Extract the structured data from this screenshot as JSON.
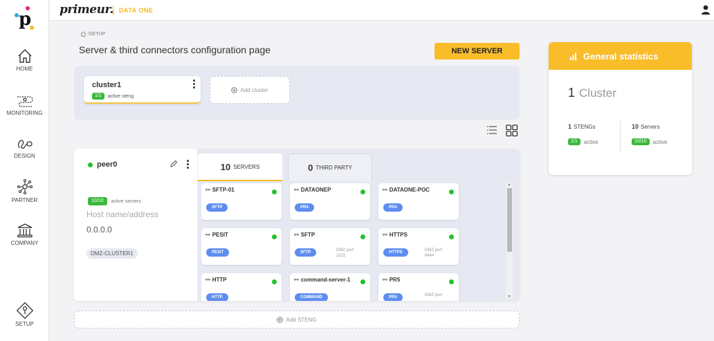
{
  "brand": {
    "name": "primeur.",
    "product": "DATA ONE"
  },
  "nav": [
    {
      "id": "home",
      "label": "HOME"
    },
    {
      "id": "monitoring",
      "label": "MONITORING"
    },
    {
      "id": "design",
      "label": "DESIGN"
    },
    {
      "id": "partner",
      "label": "PARTNER"
    },
    {
      "id": "company",
      "label": "COMPANY"
    },
    {
      "id": "setup",
      "label": "SETUP"
    }
  ],
  "breadcrumb": "/SETUP",
  "page_title": "Server & third connectors configuration page",
  "new_server_label": "NEW SERVER",
  "cluster": {
    "name": "cluster1",
    "badge": "1/1",
    "status": "active steng",
    "add_label": "Add cluster"
  },
  "peer": {
    "name": "peer0",
    "active_badge": "10/10",
    "active_label": "active servers",
    "host_placeholder": "Host name/address",
    "ip": "0.0.0.0",
    "dmz": "DMZ-CLUSTER1"
  },
  "tabs": {
    "servers": {
      "count": "10",
      "label": "SERVERS"
    },
    "third_party": {
      "count": "0",
      "label": "THIRD PARTY"
    }
  },
  "servers": [
    {
      "name": "SFTP-01",
      "protocol": "SFTP",
      "port_label": "",
      "port": ""
    },
    {
      "name": "DATAONEP",
      "protocol": "PR4",
      "port_label": "",
      "port": ""
    },
    {
      "name": "DATAONE-POC",
      "protocol": "PR4",
      "port_label": "",
      "port": ""
    },
    {
      "name": "PESIT",
      "protocol": "PESIT",
      "port_label": "",
      "port": ""
    },
    {
      "name": "SFTP",
      "protocol": "SFTP",
      "port_label": "DMZ port",
      "port": "2222"
    },
    {
      "name": "HTTPS",
      "protocol": "HTTPS",
      "port_label": "DMZ port",
      "port": "8444"
    },
    {
      "name": "HTTP",
      "protocol": "HTTP",
      "port_label": "",
      "port": ""
    },
    {
      "name": "command-server-1",
      "protocol": "COMMAND",
      "port_label": "",
      "port": ""
    },
    {
      "name": "PR5",
      "protocol": "PR5",
      "port_label": "DMZ port",
      "port": ""
    }
  ],
  "add_steng_label": "Add STENG",
  "stats": {
    "title": "General statistics",
    "cluster_count": "1",
    "cluster_label": "Cluster",
    "stengs_count": "1",
    "stengs_label": "STENGs",
    "stengs_badge": "1/1",
    "stengs_status": "active",
    "servers_count": "10",
    "servers_label": "Servers",
    "servers_badge": "10/10",
    "servers_status": "active"
  },
  "colors": {
    "accent": "#f9bd2a",
    "active_green": "#22c02c",
    "protocol_blue": "#5e8df0",
    "band": "#e6e9f2"
  },
  "icons": {
    "home": "home-icon",
    "monitoring": "monitoring-icon",
    "design": "design-icon",
    "partner": "partner-icon",
    "company": "company-icon",
    "setup": "setup-icon",
    "user": "user-icon",
    "plug": "plug-icon",
    "list_view": "list-view-icon",
    "grid_view": "grid-view-icon",
    "edit": "pencil-icon",
    "more": "kebab-icon",
    "add": "plus-circle-icon",
    "stats": "bar-chart-icon"
  }
}
